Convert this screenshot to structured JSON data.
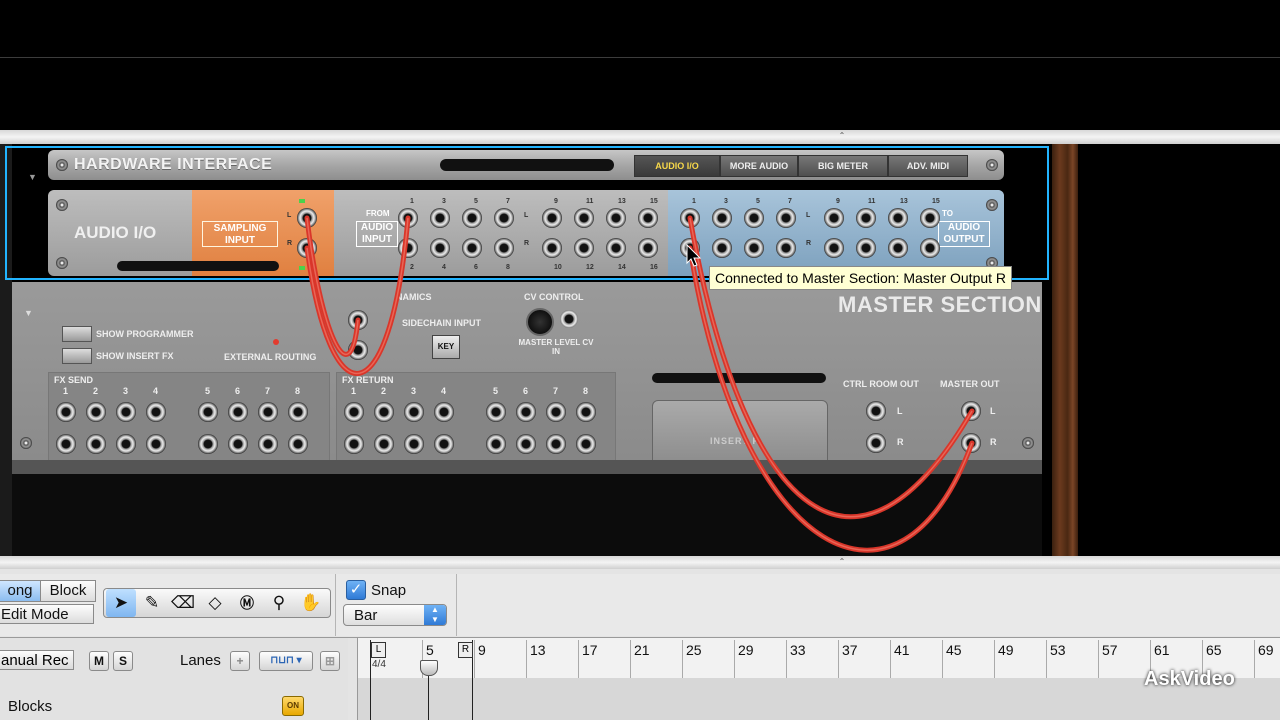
{
  "hardware_interface": {
    "title": "HARDWARE INTERFACE",
    "tabs": [
      "AUDIO I/O",
      "MORE AUDIO",
      "BIG METER",
      "ADV. MIDI"
    ],
    "audio_io_label": "AUDIO I/O",
    "sampling_input": "SAMPLING INPUT",
    "from_label": "FROM",
    "from_box": "AUDIO INPUT",
    "to_label": "TO",
    "to_box": "AUDIO OUTPUT",
    "channel_L": "L",
    "channel_R": "R",
    "input_numbers_top": [
      "1",
      "3",
      "5",
      "7",
      "9",
      "11",
      "13",
      "15"
    ],
    "input_numbers_bottom": [
      "2",
      "4",
      "6",
      "8",
      "10",
      "12",
      "14",
      "16"
    ],
    "output_numbers_top": [
      "1",
      "3",
      "5",
      "7",
      "9",
      "11",
      "13",
      "15"
    ]
  },
  "tooltip": "Connected to Master Section: Master Output R",
  "master_section": {
    "title": "MASTER SECTION",
    "show_programmer": "SHOW PROGRAMMER",
    "show_insert_fx": "SHOW INSERT FX",
    "external_routing": "EXTERNAL ROUTING",
    "dynamics": "NAMICS",
    "sidechain_input": "SIDECHAIN INPUT",
    "key": "KEY",
    "cv_control": "CV CONTROL",
    "master_level_cv_in": "MASTER LEVEL CV IN",
    "fx_send": "FX SEND",
    "fx_return": "FX RETURN",
    "fx_numbers": [
      "1",
      "2",
      "3",
      "4",
      "5",
      "6",
      "7",
      "8"
    ],
    "insert_fx": "INSERT F",
    "ctrl_room_out": "CTRL ROOM OUT",
    "master_out": "MASTER OUT"
  },
  "sequencer": {
    "song_tab": "ong",
    "block_tab": "Block",
    "edit_mode": "Edit Mode",
    "snap_label": "Snap",
    "snap_checked": true,
    "snap_value": "Bar",
    "manual_rec": "anual Rec",
    "mute": "M",
    "solo": "S",
    "lanes_label": "Lanes",
    "blocks_label": "Blocks",
    "blocks_on": "ON",
    "time_signature": "4/4",
    "ruler_numbers": [
      "5",
      "9",
      "13",
      "17",
      "21",
      "25",
      "29",
      "33",
      "37",
      "41",
      "45",
      "49",
      "53",
      "57",
      "61",
      "65",
      "69"
    ],
    "loop_left": "L",
    "loop_right": "R",
    "tools": [
      "select-arrow",
      "pencil",
      "eraser",
      "razor",
      "mute-tool",
      "magnify",
      "hand"
    ]
  },
  "watermark": "AskVideo",
  "colors": {
    "selection_frame": "#22b4ff",
    "cable": "#e0392b",
    "sampling_panel": "#e8915a",
    "output_panel": "#93b4cf"
  }
}
